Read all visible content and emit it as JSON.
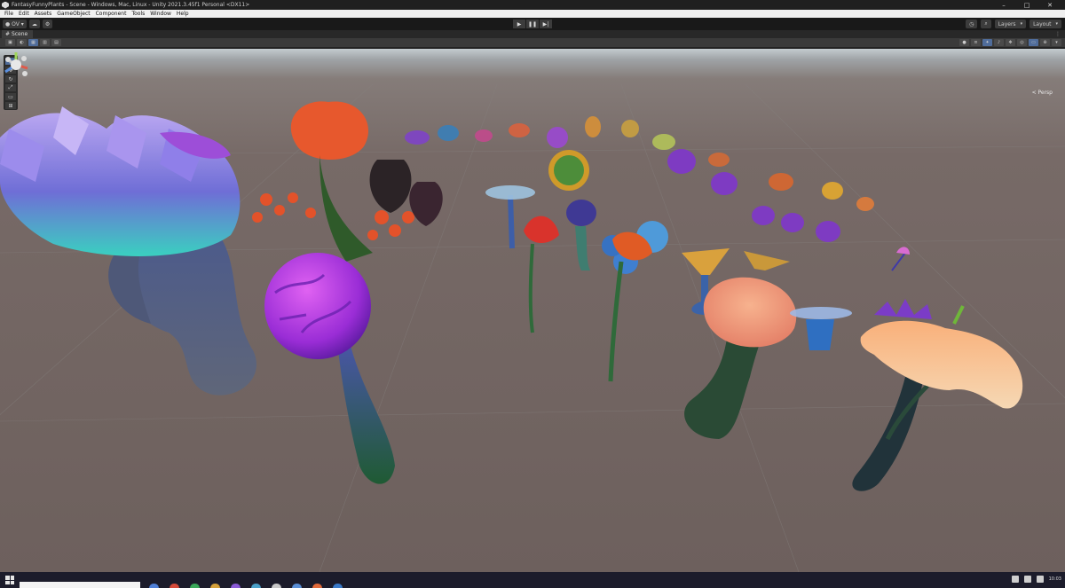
{
  "window": {
    "title": "FantasyFunnyPlants - Scene - Windows, Mac, Linux - Unity 2021.3.45f1 Personal <DX11>",
    "controls": [
      "–",
      "□",
      "✕"
    ]
  },
  "menu": [
    "File",
    "Edit",
    "Assets",
    "GameObject",
    "Component",
    "Tools",
    "Window",
    "Help"
  ],
  "toolbar": {
    "account": "OV",
    "cloud_icon": "cloud-icon",
    "play_controls": [
      "▶",
      "❚❚",
      "▶|"
    ],
    "history_icon": "history-icon",
    "search_icon": "search-icon",
    "layers_label": "Layers",
    "layout_label": "Layout"
  },
  "scene_tab": {
    "label": "Scene",
    "more": "⋮"
  },
  "scene_view": {
    "camera_label": "< Persp",
    "tools": [
      "view",
      "move",
      "rotate",
      "scale",
      "rect",
      "transform"
    ]
  },
  "taskbar": {
    "time": "10:03"
  },
  "colors": {
    "editor_dark": "#1e1e1e",
    "menu_bg": "#f0f0f0",
    "ground": "#6d605d",
    "sky": "#c3cbcf",
    "accent_blue": "#4f6c9a"
  }
}
